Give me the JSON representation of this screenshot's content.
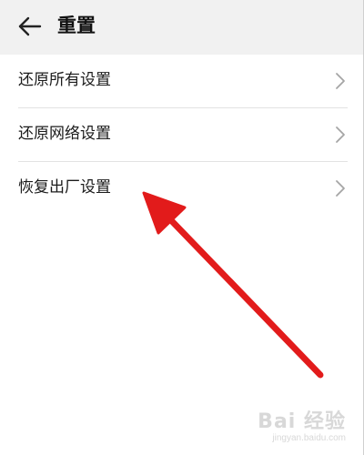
{
  "header": {
    "back_icon": "arrow-left-icon",
    "title": "重置"
  },
  "settings": {
    "items": [
      {
        "label": "还原所有设置",
        "icon": "chevron-right-icon"
      },
      {
        "label": "还原网络设置",
        "icon": "chevron-right-icon"
      },
      {
        "label": "恢复出厂设置",
        "icon": "chevron-right-icon"
      }
    ]
  },
  "annotation": {
    "color": "#e21b1b",
    "points_to": "恢复出厂设置"
  },
  "watermark": {
    "brand": "Bai 经验",
    "url": "jingyan.baidu.com"
  },
  "colors": {
    "page_background": "#f1f1f1",
    "list_background": "#ffffff",
    "text": "#1b1b1b",
    "divider": "#e3e3e3",
    "chevron": "#a5a5a5"
  }
}
